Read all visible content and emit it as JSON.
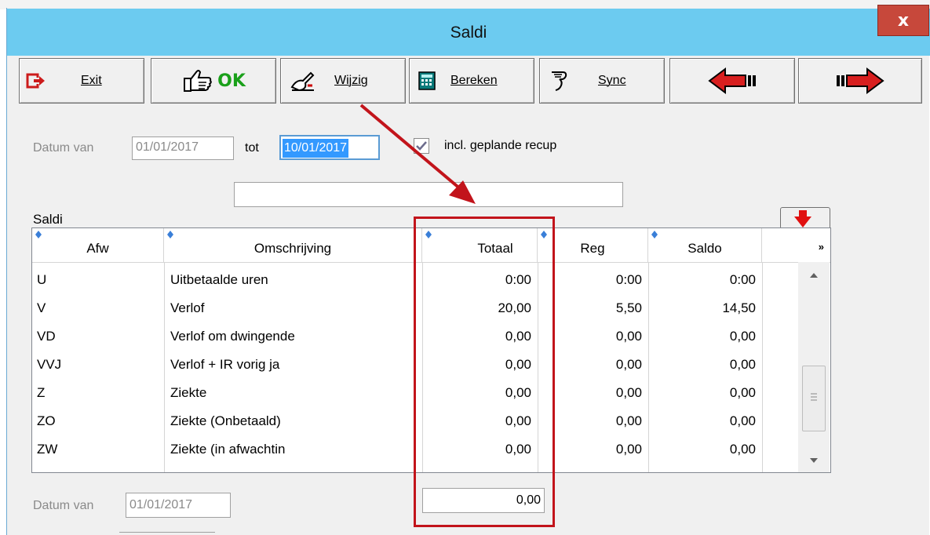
{
  "window": {
    "title": "Saldi",
    "close_label": "x"
  },
  "toolbar": {
    "exit_label": "Exit",
    "ok_label": "OK",
    "wijzig_label": "Wijzig",
    "bereken_label": "Bereken",
    "sync_label": "Sync"
  },
  "filter": {
    "datum_van_label": "Datum van",
    "datum_van_value": "01/01/2017",
    "tot_label": "tot",
    "tot_value": "10/01/2017",
    "recup_label": "incl. geplande recup",
    "recup_checked": true,
    "search_value": ""
  },
  "grid": {
    "label": "Saldi",
    "columns": [
      "Afw",
      "Omschrijving",
      "Totaal",
      "Reg",
      "Saldo",
      "»"
    ],
    "rows": [
      {
        "afw": "U",
        "omschrijving": "Uitbetaalde uren",
        "totaal": "0:00",
        "reg": "0:00",
        "saldo": "0:00"
      },
      {
        "afw": "V",
        "omschrijving": "Verlof",
        "totaal": "20,00",
        "reg": "5,50",
        "saldo": "14,50"
      },
      {
        "afw": "VD",
        "omschrijving": "Verlof om dwingende",
        "totaal": "0,00",
        "reg": "0,00",
        "saldo": "0,00"
      },
      {
        "afw": "VVJ",
        "omschrijving": "Verlof + IR vorig ja",
        "totaal": "0,00",
        "reg": "0,00",
        "saldo": "0,00"
      },
      {
        "afw": "Z",
        "omschrijving": "Ziekte",
        "totaal": "0,00",
        "reg": "0,00",
        "saldo": "0,00"
      },
      {
        "afw": "ZO",
        "omschrijving": "Ziekte (Onbetaald)",
        "totaal": "0,00",
        "reg": "0,00",
        "saldo": "0,00"
      },
      {
        "afw": "ZW",
        "omschrijving": "Ziekte (in afwachtin",
        "totaal": "0,00",
        "reg": "0,00",
        "saldo": "0,00"
      }
    ]
  },
  "footer": {
    "datum_van_label": "Datum van",
    "datum_van_value": "01/01/2017",
    "total_value": "0,00"
  },
  "colors": {
    "titlebar": "#6ccbf0",
    "close": "#c7483b",
    "annotation_red": "#c2141b",
    "selection": "#3399ff"
  },
  "icons": {
    "exit": "exit-door-icon",
    "ok": "thumbs-up-icon",
    "wijzig": "pencil-hand-icon",
    "bereken": "calculator-icon",
    "sync": "sync-hand-icon",
    "prev": "red-arrow-left-icon",
    "next": "red-arrow-right-icon",
    "export": "download-arrow-icon"
  }
}
